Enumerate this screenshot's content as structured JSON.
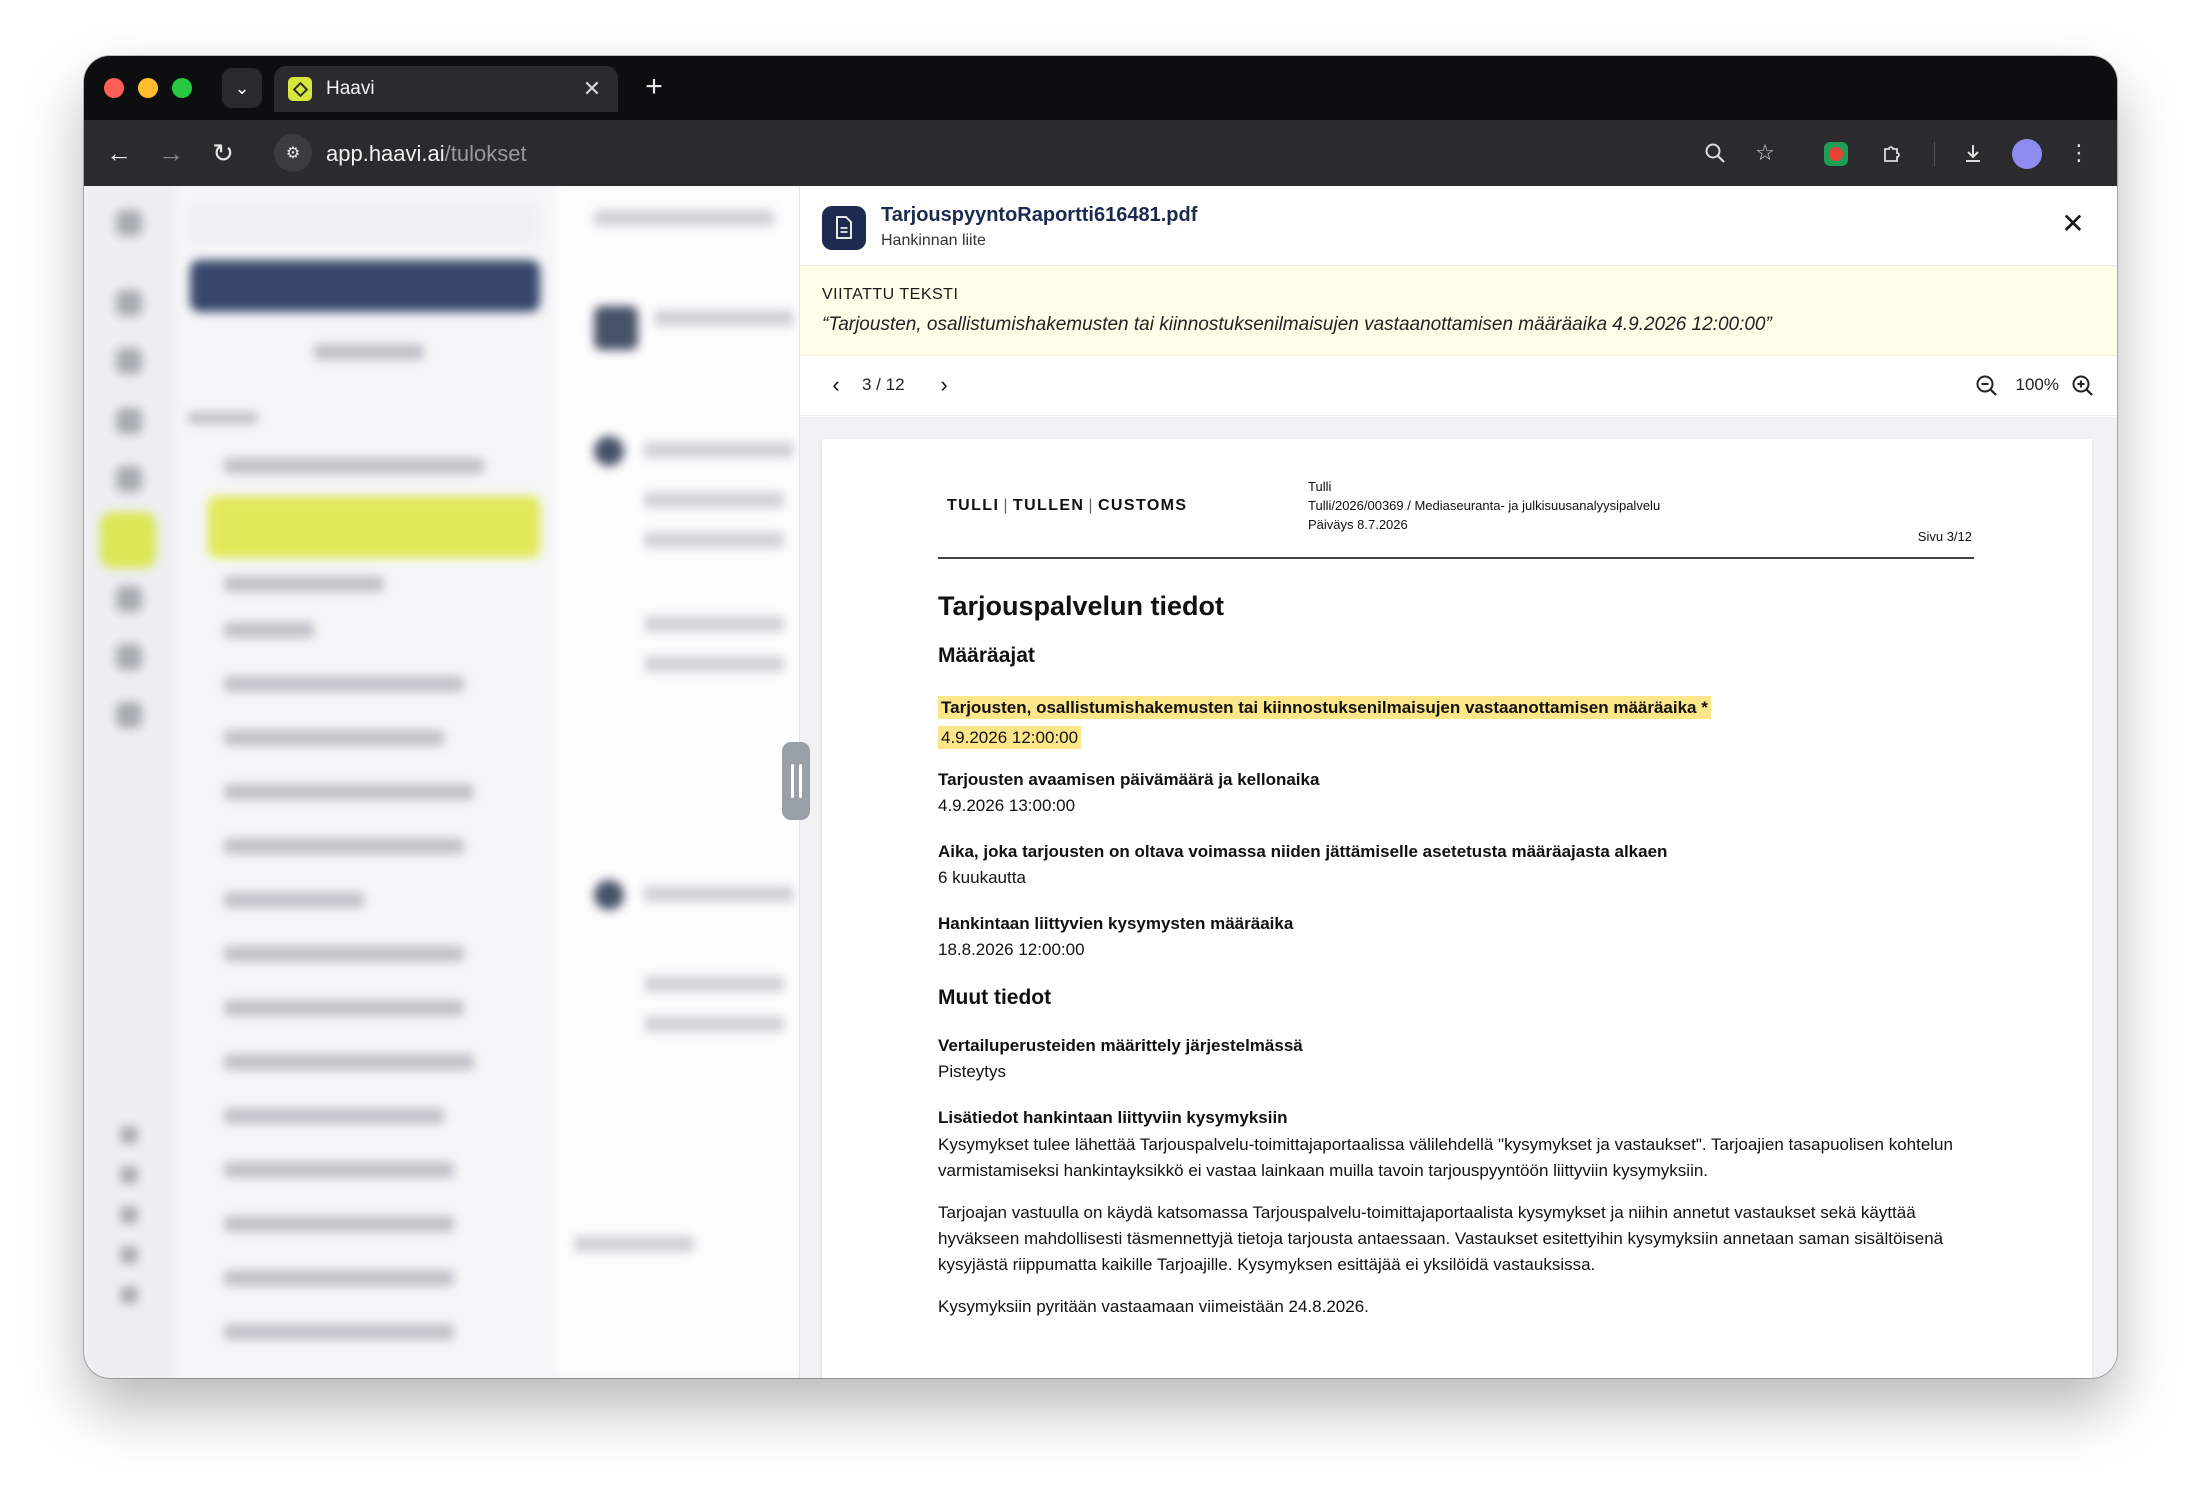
{
  "browser": {
    "tab_title": "Haavi",
    "url_host": "app.haavi.ai",
    "url_path": "/tulokset"
  },
  "preview": {
    "file_name": "TarjouspyyntoRaportti616481.pdf",
    "file_subtitle": "Hankinnan liite",
    "quote_label": "VIITATTU TEKSTI",
    "quote_text": "“Tarjousten, osallistumishakemusten tai kiinnostuksenilmaisujen vastaanottamisen määräaika 4.9.2026 12:00:00”",
    "page_indicator": "3 / 12",
    "zoom_level": "100%"
  },
  "document": {
    "logo_parts": [
      "TULLI",
      "TULLEN",
      "CUSTOMS"
    ],
    "meta_line1": "Tulli",
    "meta_line2": "Tulli/2026/00369 / Mediaseuranta- ja julkisuusanalyysipalvelu",
    "meta_line3": "Päiväys 8.7.2026",
    "page_label": "Sivu 3/12",
    "title": "Tarjouspalvelun tiedot",
    "section1": "Määräajat",
    "items": [
      {
        "label": "Tarjousten, osallistumishakemusten tai kiinnostuksenilmaisujen vastaanottamisen määräaika *",
        "value": "4.9.2026 12:00:00"
      },
      {
        "label": "Tarjousten avaamisen päivämäärä ja kellonaika",
        "value": "4.9.2026 13:00:00"
      },
      {
        "label": "Aika, joka tarjousten on oltava voimassa niiden jättämiselle asetetusta määräajasta alkaen",
        "value": "6 kuukautta"
      },
      {
        "label": "Hankintaan liittyvien kysymysten määräaika",
        "value": "18.8.2026 12:00:00"
      }
    ],
    "section2": "Muut tiedot",
    "items2": [
      {
        "label": "Vertailuperusteiden määrittely järjestelmässä",
        "value": "Pisteytys"
      }
    ],
    "qa_label": "Lisätiedot hankintaan liittyviin kysymyksiin",
    "qa_para1": "Kysymykset tulee lähettää Tarjouspalvelu-toimittajaportaalissa välilehdellä \"kysymykset ja vastaukset\". Tarjoajien tasapuolisen kohtelun varmistamiseksi hankintayksikkö ei vastaa lainkaan muilla tavoin tarjouspyyntöön liittyviin kysymyksiin.",
    "qa_para2": "Tarjoajan vastuulla on käydä katsomassa Tarjouspalvelu-toimittajaportaalista kysymykset ja niihin annetut vastaukset sekä käyttää hyväkseen mahdollisesti täsmennettyjä tietoja tarjousta antaessaan. Vastaukset esitettyihin kysymyksiin annetaan saman sisältöisenä kysyjästä riippumatta kaikille Tarjoajille. Kysymyksen esittäjää ei yksilöidä vastauksissa.",
    "qa_para3": "Kysymyksiin pyritään vastaamaan viimeistään 24.8.2026."
  },
  "colors": {
    "accent": "#d7e63a",
    "navy": "#1b2a4e",
    "highlight": "#fde68a",
    "quote_bg": "#fdfde8"
  }
}
